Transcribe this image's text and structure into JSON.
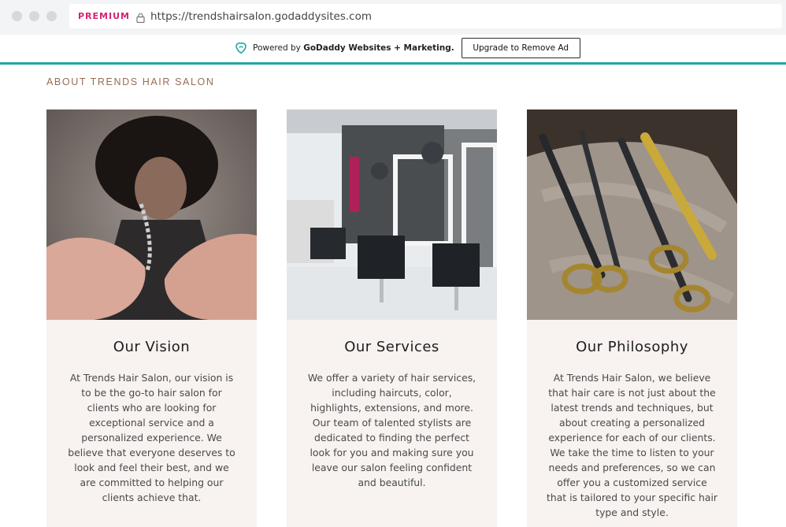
{
  "browser": {
    "badge": "PREMIUM",
    "url": "https://trendshairsalon.godaddysites.com",
    "icons": [
      "lock-icon"
    ]
  },
  "adbar": {
    "powered_prefix": "Powered by ",
    "powered_brand": "GoDaddy Websites + Marketing.",
    "upgrade_label": "Upgrade to Remove Ad",
    "accent_color": "#1fa8a4"
  },
  "section": {
    "title": "ABOUT TRENDS HAIR SALON"
  },
  "cards": [
    {
      "title": "Our Vision",
      "text": "At Trends Hair Salon, our vision is to be the go-to hair salon for clients who are looking for exceptional service and a personalized experience. We believe that everyone deserves to look and feel their best, and we are committed to helping our clients achieve that."
    },
    {
      "title": "Our Services",
      "text": "We offer a variety of hair services, including haircuts, color, highlights, extensions, and more. Our team of talented stylists are dedicated to finding the perfect look for you and making sure you leave our salon feeling confident and beautiful."
    },
    {
      "title": "Our Philosophy",
      "text": "At Trends Hair Salon, we believe that hair care is not just about the latest trends and techniques, but about creating a personalized experience for each of our clients. We take the time to listen to your needs and preferences, so we can offer you a customized service that is tailored to your specific hair type and style."
    }
  ],
  "colors": {
    "card_background": "#f8f2f0",
    "section_title": "#9a6b55",
    "premium_badge": "#d6246e"
  }
}
